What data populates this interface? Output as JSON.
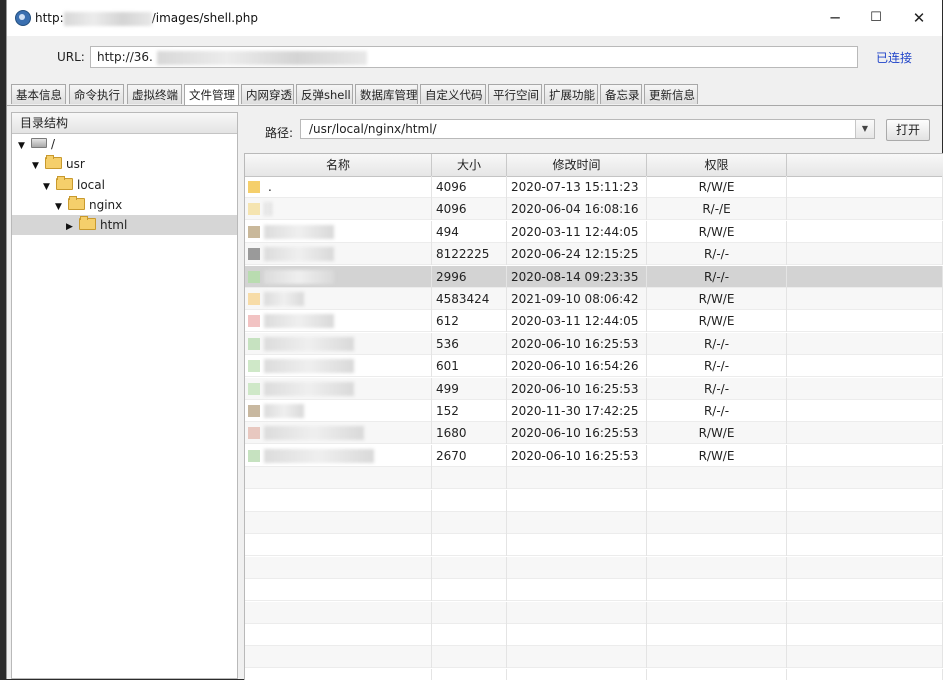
{
  "window": {
    "title_prefix": "http:",
    "title_suffix": "/images/shell.php",
    "minimize": "─",
    "maximize": "☐",
    "close": "✕"
  },
  "urlbar": {
    "label": "URL:",
    "value": "http://36.",
    "status": "已连接"
  },
  "tabs": [
    "基本信息",
    "命令执行",
    "虚拟终端",
    "文件管理",
    "内网穿透",
    "反弹shell",
    "数据库管理",
    "自定义代码",
    "平行空间",
    "扩展功能",
    "备忘录",
    "更新信息"
  ],
  "active_tab": "文件管理",
  "tree": {
    "header": "目录结构",
    "nodes": [
      "/",
      "usr",
      "local",
      "nginx",
      "html"
    ]
  },
  "path": {
    "label": "路径:",
    "value": "/usr/local/nginx/html/",
    "open_button": "打开"
  },
  "table": {
    "columns": [
      "名称",
      "大小",
      "修改时间",
      "权限"
    ],
    "rows": [
      {
        "name": ".",
        "size": "4096",
        "time": "2020-07-13 15:11:23",
        "perm": "R/W/E",
        "icon_color": "#f5cf6b"
      },
      {
        "name": "",
        "size": "4096",
        "time": "2020-06-04 16:08:16",
        "perm": "R/-/E",
        "icon_color": "#f5e4b0"
      },
      {
        "name": "",
        "size": "494",
        "time": "2020-03-11 12:44:05",
        "perm": "R/W/E",
        "icon_color": "#c9b89a"
      },
      {
        "name": "",
        "size": "8122225",
        "time": "2020-06-24 12:15:25",
        "perm": "R/-/-",
        "icon_color": "#9a9a9a"
      },
      {
        "name": "",
        "size": "2996",
        "time": "2020-08-14 09:23:35",
        "perm": "R/-/-",
        "icon_color": "#b9dcb0"
      },
      {
        "name": "",
        "size": "4583424",
        "time": "2021-09-10 08:06:42",
        "perm": "R/W/E",
        "icon_color": "#f7dca8"
      },
      {
        "name": "",
        "size": "612",
        "time": "2020-03-11 12:44:05",
        "perm": "R/W/E",
        "icon_color": "#f2c3c3"
      },
      {
        "name": "",
        "size": "536",
        "time": "2020-06-10 16:25:53",
        "perm": "R/-/-",
        "icon_color": "#c6e2c0"
      },
      {
        "name": "",
        "size": "601",
        "time": "2020-06-10 16:54:26",
        "perm": "R/-/-",
        "icon_color": "#cfe8c8"
      },
      {
        "name": "",
        "size": "499",
        "time": "2020-06-10 16:25:53",
        "perm": "R/-/-",
        "icon_color": "#cfe8c8"
      },
      {
        "name": "",
        "size": "152",
        "time": "2020-11-30 17:42:25",
        "perm": "R/-/-",
        "icon_color": "#c8b8a0"
      },
      {
        "name": "",
        "size": "1680",
        "time": "2020-06-10 16:25:53",
        "perm": "R/W/E",
        "icon_color": "#e8c8c0"
      },
      {
        "name": "",
        "size": "2670",
        "time": "2020-06-10 16:25:53",
        "perm": "R/W/E",
        "icon_color": "#c6e2c0"
      }
    ],
    "selected_index": 4
  },
  "colors": {
    "link_status": "#1f44c9",
    "selection": "#d3d3d3"
  }
}
